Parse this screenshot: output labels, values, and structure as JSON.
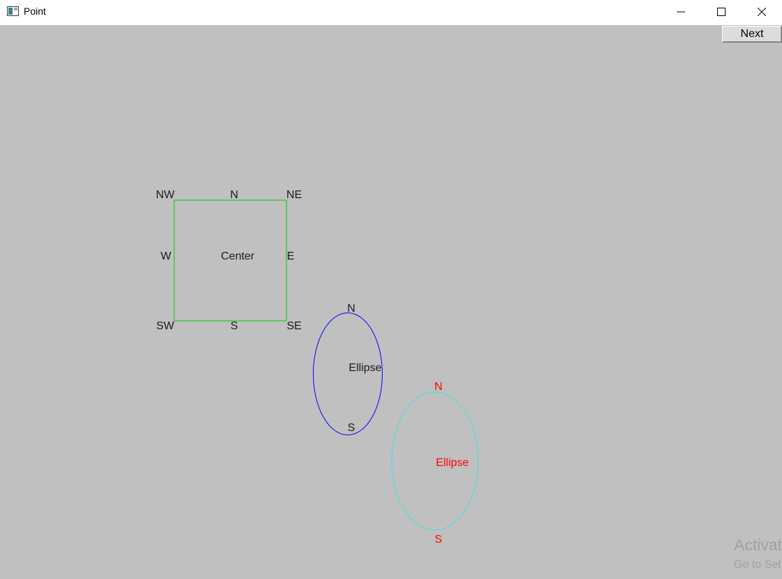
{
  "window": {
    "title": "Point",
    "app_icon": "window-app-icon",
    "controls": {
      "minimize": "minimize-icon",
      "maximize": "maximize-icon",
      "close": "close-icon"
    }
  },
  "toolbar": {
    "next_label": "Next"
  },
  "rectangle": {
    "color": "#00cc00",
    "labels": {
      "nw": "NW",
      "n": "N",
      "ne": "NE",
      "w": "W",
      "center": "Center",
      "e": "E",
      "sw": "SW",
      "s": "S",
      "se": "SE"
    }
  },
  "ellipse_blue": {
    "color": "#0000ff",
    "label_color": "#1a1a1a",
    "labels": {
      "n": "N",
      "center": "Ellipse",
      "s": "S"
    }
  },
  "ellipse_cyan": {
    "color": "#40e0e0",
    "label_color": "#ff0000",
    "labels": {
      "n": "N",
      "center": "Ellipse",
      "s": "S"
    }
  },
  "watermark": {
    "line1": "Activate Windows",
    "line2": "Go to Settings to activate Windows."
  },
  "colors": {
    "canvas_background": "#c0c0c0",
    "titlebar": "#ffffff"
  }
}
